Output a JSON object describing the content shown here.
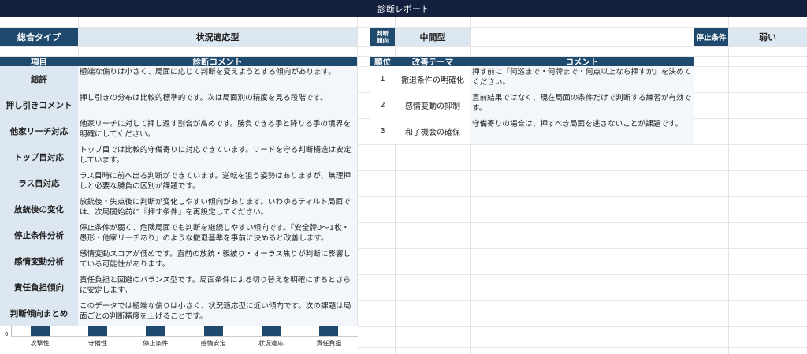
{
  "title": "診断レポート",
  "summary": {
    "type_label": "総合タイプ",
    "type_value": "状況適応型",
    "tendency_label": "判断傾向",
    "tendency_value": "中間型",
    "stop_label": "停止条件",
    "stop_value": "弱い"
  },
  "left_table": {
    "header_item": "項目",
    "header_comment": "診断コメント",
    "rows": [
      {
        "label": "総評",
        "comment": "極端な偏りは小さく、局面に応じて判断を変えようとする傾向があります。"
      },
      {
        "label": "押し引きコメント",
        "comment": "押し引きの分布は比較的標準的です。次は局面別の精度を見る段階です。"
      },
      {
        "label": "他家リーチ対応",
        "comment": "他家リーチに対して押し返す割合が高めです。勝負できる手と降りる手の境界を明確にしてください。"
      },
      {
        "label": "トップ目対応",
        "comment": "トップ目では比較的守備寄りに対応できています。リードを守る判断構造は安定しています。"
      },
      {
        "label": "ラス目対応",
        "comment": "ラス目時に前へ出る判断ができています。逆転を狙う姿勢はありますが、無理押しと必要な勝負の区別が課題です。"
      },
      {
        "label": "放銃後の変化",
        "comment": "放銃後・失点後に判断が変化しやすい傾向があります。いわゆるティルト局面では、次局開始前に『押す条件』を再設定してください。"
      },
      {
        "label": "停止条件分析",
        "comment": "停止条件が弱く、危険局面でも判断を継続しやすい傾向です。『安全牌0～1枚・愚形・他家リーチあり』のような撤退基準を事前に決めると改善します。"
      },
      {
        "label": "感情変動分析",
        "comment": "感情変動スコアが低めです。直前の放銃・親被り・オーラス焦りが判断に影響している可能性があります。"
      },
      {
        "label": "責任負担傾向",
        "comment": "責任負担と回避のバランス型です。局面条件による切り替えを明確にするとさらに安定します。"
      },
      {
        "label": "判断傾向まとめ",
        "comment": "このデータでは極端な偏りは小さく、状況適応型に近い傾向です。次の課題は局面ごとの判断精度を上げることです。"
      }
    ]
  },
  "right_table": {
    "header_rank": "順位",
    "header_theme": "改善テーマ",
    "header_comment": "コメント",
    "rows": [
      {
        "rank": "1",
        "theme": "撤退条件の明確化",
        "comment": "押す前に『何巡まで・何牌まで・何点以上なら押すか』を決めてください。"
      },
      {
        "rank": "2",
        "theme": "感情変動の抑制",
        "comment": "直前結果ではなく、現在局面の条件だけで判断する練習が有効です。"
      },
      {
        "rank": "3",
        "theme": "和了機会の確保",
        "comment": "守備寄りの場合は、押すべき局面を逃さないことが課題です。"
      }
    ]
  },
  "chart_data": {
    "type": "bar",
    "categories": [
      "攻撃性",
      "守備性",
      "停止条件",
      "感情安定",
      "状況適応",
      "責任負担"
    ],
    "y_tick_label": "0"
  }
}
